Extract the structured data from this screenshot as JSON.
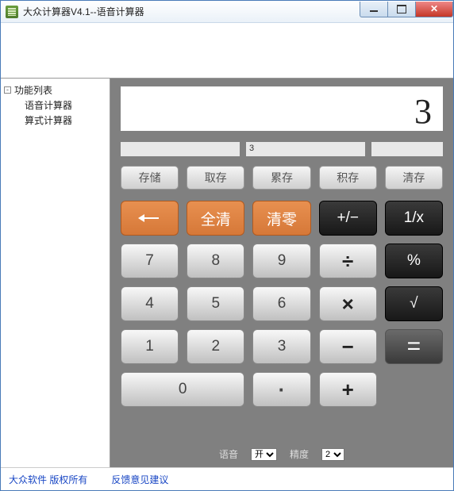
{
  "window": {
    "title": "大众计算器V4.1--语音计算器"
  },
  "sidebar": {
    "root": "功能列表",
    "items": [
      "语音计算器",
      "算式计算器"
    ],
    "expand_symbol": "-"
  },
  "display": {
    "main": "3",
    "sub1": "",
    "sub2": "3",
    "sub3": ""
  },
  "memory": {
    "store": "存储",
    "recall": "取存",
    "accum": "累存",
    "mult": "积存",
    "clear": "清存"
  },
  "buttons": {
    "allclear": "全清",
    "clearentry": "清零",
    "plusminus": "+/−",
    "reciprocal": "1/x",
    "seven": "7",
    "eight": "8",
    "nine": "9",
    "divide": "÷",
    "percent": "%",
    "four": "4",
    "five": "5",
    "six": "6",
    "multiply": "×",
    "sqrt": "√",
    "one": "1",
    "two": "2",
    "three": "3",
    "minus": "−",
    "zero": "0",
    "dot": "·",
    "plus": "+",
    "equals": "="
  },
  "bottom": {
    "voice_label": "语音",
    "voice_value": "开",
    "precision_label": "精度",
    "precision_value": "2"
  },
  "footer": {
    "copyright": "大众软件 版权所有",
    "feedback": "反馈意见建议"
  }
}
